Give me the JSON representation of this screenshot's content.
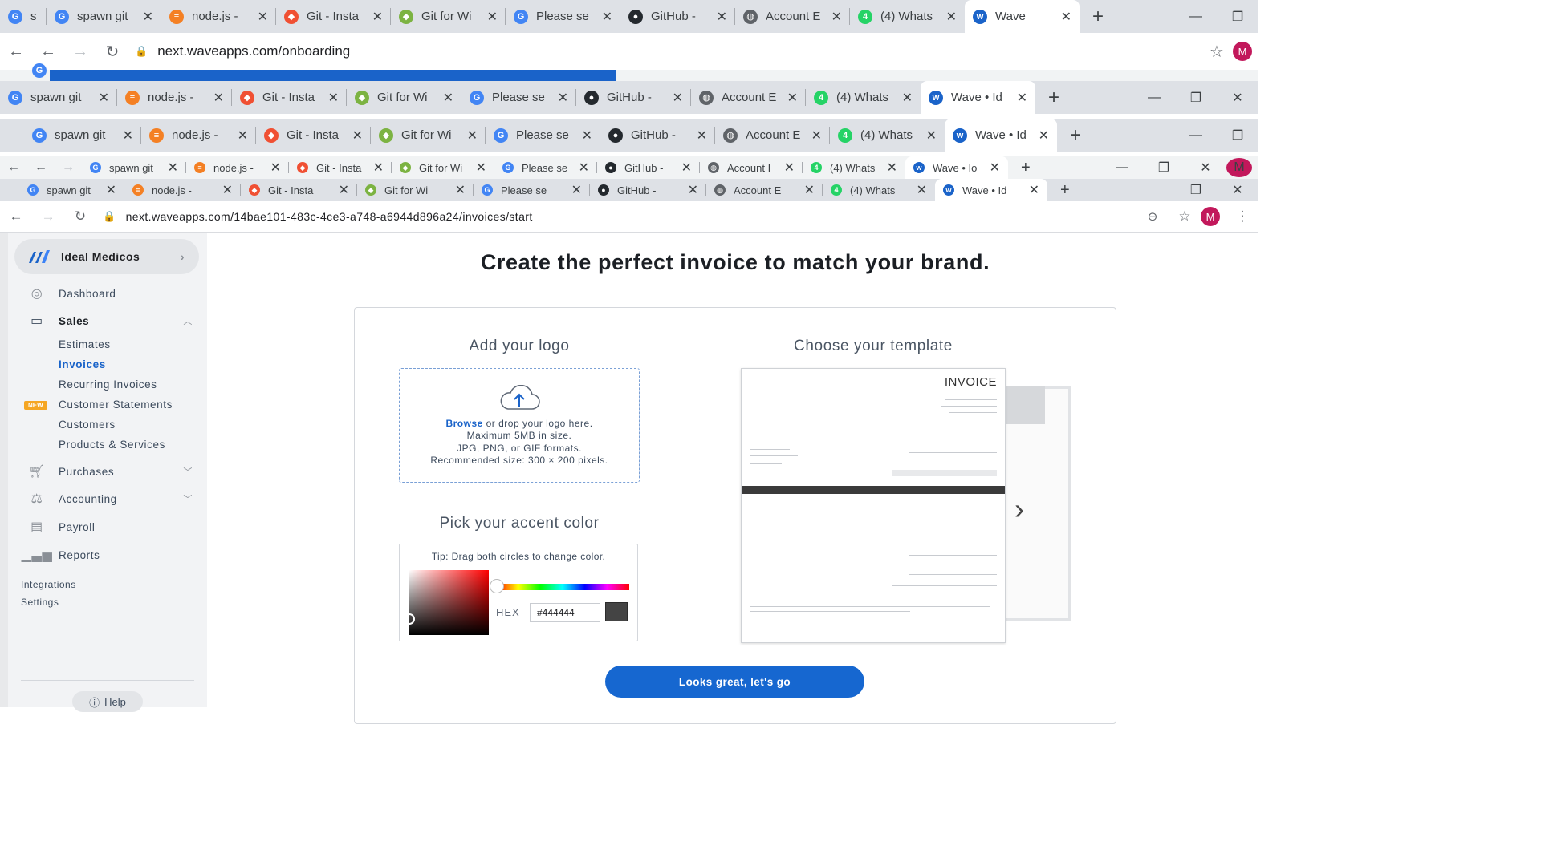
{
  "browser1": {
    "tabs": [
      "s",
      "spawn git",
      "node.js -",
      "Git - Insta",
      "Git for Wi",
      "Please se",
      "GitHub - ",
      "Account E",
      "(4) Whats",
      "Wave"
    ],
    "url": "next.waveapps.com/onboarding"
  },
  "browser2": {
    "tabs": [
      "spawn git",
      "node.js -",
      "Git - Insta",
      "Git for Wi",
      "Please se",
      "GitHub - ",
      "Account E",
      "(4) Whats",
      "Wave • Id"
    ]
  },
  "browser3": {
    "tabs": [
      "spawn git",
      "node.js -",
      "Git - Insta",
      "Git for Wi",
      "Please se",
      "GitHub - ",
      "Account E",
      "(4) Whats",
      "Wave • Id"
    ]
  },
  "browser4": {
    "tabs": [
      "spawn git",
      "node.js -",
      "Git - Insta",
      "Git for Wi",
      "Please se",
      "GitHub - ",
      "Account I",
      "(4) Whats",
      "Wave • Io"
    ]
  },
  "browser5": {
    "tabs": [
      "spawn git",
      "node.js -",
      "Git - Insta",
      "Git for Wi",
      "Please se",
      "GitHub - ",
      "Account E",
      "(4) Whats",
      "Wave • Id"
    ],
    "url": "next.waveapps.com/14bae101-483c-4ce3-a748-a6944d896a24/invoices/start"
  },
  "avatar_letter": "M",
  "sidebar": {
    "business": "Ideal Medicos",
    "dashboard": "Dashboard",
    "sales": "Sales",
    "sales_items": [
      "Estimates",
      "Invoices",
      "Recurring Invoices",
      "Customer Statements",
      "Customers",
      "Products & Services"
    ],
    "new_badge": "NEW",
    "purchases": "Purchases",
    "accounting": "Accounting",
    "payroll": "Payroll",
    "reports": "Reports",
    "integrations": "Integrations",
    "settings": "Settings",
    "help": "Help"
  },
  "main": {
    "headline": "Create the perfect invoice to match your brand.",
    "logo_title": "Add your logo",
    "browse": "Browse",
    "drop_line1_rest": " or drop your logo here.",
    "drop_line2": "Maximum 5MB in size.",
    "drop_line3": "JPG, PNG, or GIF formats.",
    "drop_line4": "Recommended size: 300 × 200 pixels.",
    "color_title": "Pick your accent color",
    "tip": "Tip: Drag both circles to change color.",
    "hex_label": "HEX",
    "hex_value": "#444444",
    "accent_color": "#444444",
    "template_title": "Choose your template",
    "invoice_heading": "INVOICE",
    "cta": "Looks great, let's go"
  }
}
